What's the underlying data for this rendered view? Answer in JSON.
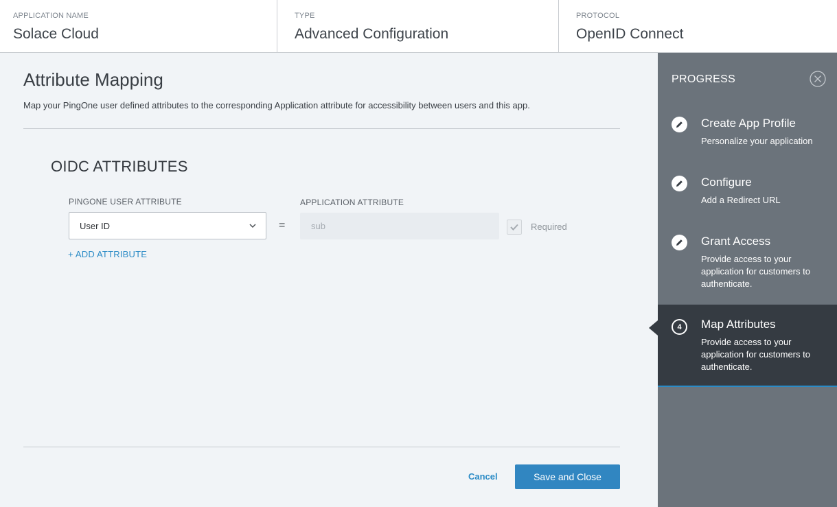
{
  "header": {
    "app_name_label": "APPLICATION NAME",
    "app_name_value": "Solace Cloud",
    "type_label": "TYPE",
    "type_value": "Advanced Configuration",
    "protocol_label": "PROTOCOL",
    "protocol_value": "OpenID Connect"
  },
  "main": {
    "title": "Attribute Mapping",
    "description": "Map your PingOne user defined attributes to the corresponding Application attribute for accessibility between users and this app.",
    "section_title": "OIDC ATTRIBUTES",
    "pingone_col_label": "PINGONE USER ATTRIBUTE",
    "app_col_label": "APPLICATION ATTRIBUTE",
    "mapping": {
      "pingone_value": "User ID",
      "equals": "=",
      "app_value": "sub",
      "required_label": "Required",
      "required_checked": true
    },
    "add_attribute": "+ ADD ATTRIBUTE",
    "cancel": "Cancel",
    "save": "Save and Close"
  },
  "sidebar": {
    "title": "PROGRESS",
    "steps": [
      {
        "icon": "pencil-icon",
        "title": "Create App Profile",
        "desc": "Personalize your application"
      },
      {
        "icon": "pencil-icon",
        "title": "Configure",
        "desc": "Add a Redirect URL"
      },
      {
        "icon": "pencil-icon",
        "title": "Grant Access",
        "desc": "Provide access to your application for customers to authenticate."
      },
      {
        "icon": "number-badge",
        "number": "4",
        "title": "Map Attributes",
        "desc": "Provide access to your application for customers to authenticate.",
        "active": true
      }
    ]
  },
  "colors": {
    "accent": "#2b8bc6",
    "sidebar_bg": "#6b737b",
    "sidebar_active_bg": "#353b42",
    "main_bg": "#f1f4f7"
  }
}
